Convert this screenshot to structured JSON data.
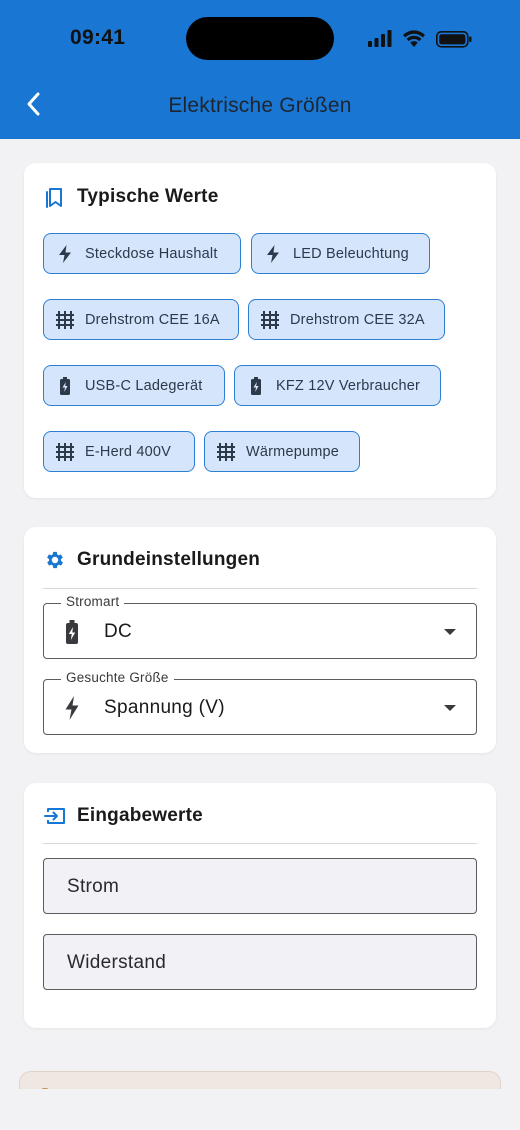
{
  "status_bar": {
    "time": "09:41"
  },
  "header": {
    "title": "Elektrische Größen",
    "back_icon": "chevron-left-icon"
  },
  "colors": {
    "primary": "#1976d2",
    "chip_bg": "#d5e5fb",
    "chip_border": "#2d7fd4",
    "background": "#f2f2f5"
  },
  "typical_values": {
    "title": "Typische Werte",
    "icon": "bookmarks-icon",
    "chips": [
      {
        "label": "Steckdose Haushalt",
        "icon": "lightning-icon"
      },
      {
        "label": "LED Beleuchtung",
        "icon": "lightning-icon"
      },
      {
        "label": "Drehstrom CEE 16A",
        "icon": "three-phase-icon"
      },
      {
        "label": "Drehstrom CEE 32A",
        "icon": "three-phase-icon"
      },
      {
        "label": "USB-C Ladegerät",
        "icon": "battery-charging-icon"
      },
      {
        "label": "KFZ 12V Verbraucher",
        "icon": "battery-charging-icon"
      },
      {
        "label": "E-Herd 400V",
        "icon": "three-phase-icon"
      },
      {
        "label": "Wärmepumpe",
        "icon": "three-phase-icon"
      }
    ]
  },
  "basic_settings": {
    "title": "Grundeinstellungen",
    "icon": "gear-icon",
    "current_type": {
      "label": "Stromart",
      "value": "DC",
      "icon": "battery-charging-icon"
    },
    "searched_quantity": {
      "label": "Gesuchte Größe",
      "value": "Spannung (V)",
      "icon": "lightning-icon"
    }
  },
  "input_values": {
    "title": "Eingabewerte",
    "icon": "input-icon",
    "fields": [
      {
        "placeholder": "Strom"
      },
      {
        "placeholder": "Widerstand"
      }
    ]
  }
}
